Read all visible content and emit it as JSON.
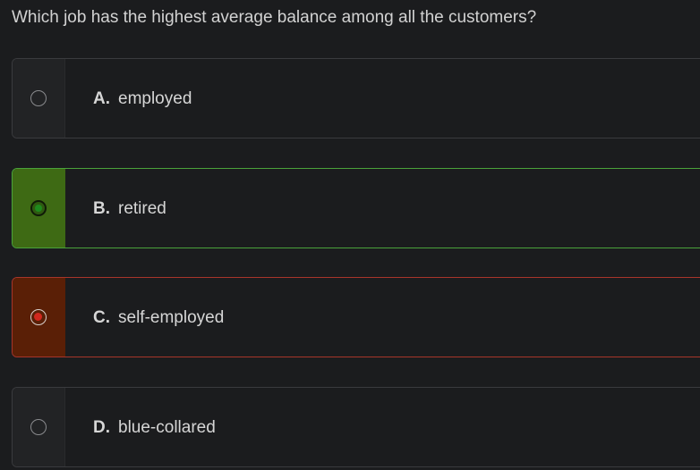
{
  "question": "Which job has the highest average balance among all the customers?",
  "options": [
    {
      "letter": "A.",
      "text": "employed",
      "state": "unselected"
    },
    {
      "letter": "B.",
      "text": "retired",
      "state": "correct"
    },
    {
      "letter": "C.",
      "text": "self-employed",
      "state": "wrong"
    },
    {
      "letter": "D.",
      "text": "blue-collared",
      "state": "unselected"
    }
  ],
  "colors": {
    "background": "#1b1c1e",
    "correct_accent": "#4aa23a",
    "correct_fill": "#3e6a14",
    "wrong_accent": "#a8352a",
    "wrong_fill": "#5a1f06",
    "text": "#d6d6d6"
  }
}
